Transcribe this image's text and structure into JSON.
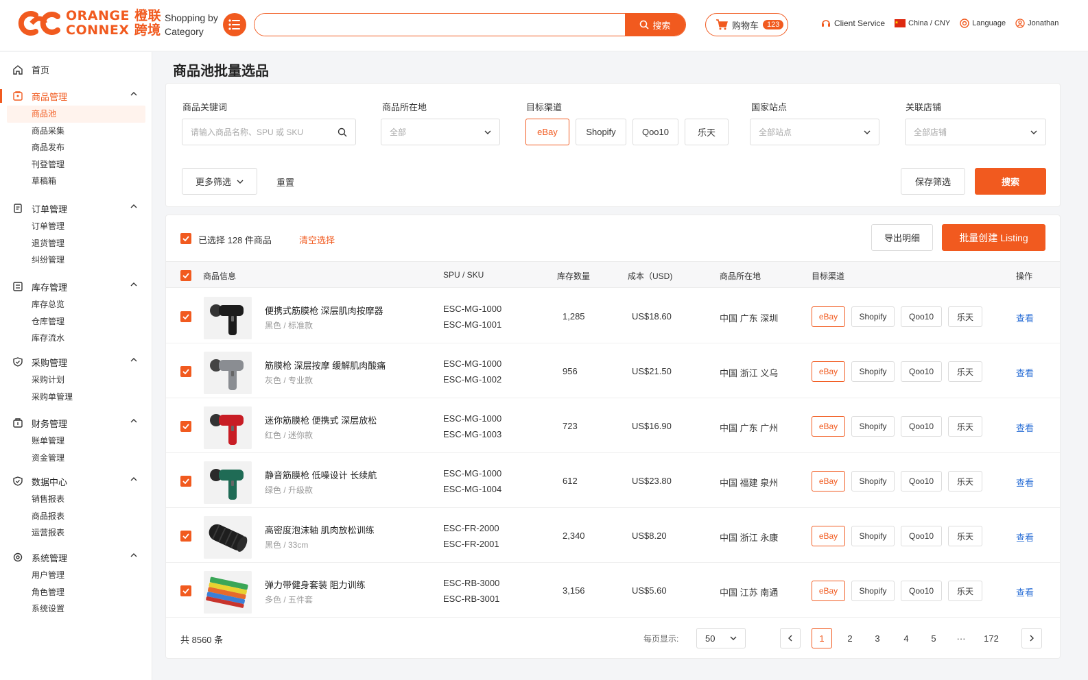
{
  "header": {
    "logo_line1": "ORANGE 橙联",
    "logo_line2": "CONNEX 跨境",
    "category_line1": "Shopping by",
    "category_line2": "Category",
    "search_button": "搜索",
    "cart_label": "购物车",
    "cart_count": "123",
    "client_service": "Client Service",
    "region": "China / CNY",
    "language": "Language",
    "user": "Jonathan"
  },
  "sidebar": {
    "home": "首页",
    "groups": [
      {
        "label": "商品管理",
        "items": [
          "商品池",
          "商品采集",
          "商品发布",
          "刊登管理",
          "草稿箱"
        ]
      },
      {
        "label": "订单管理",
        "items": [
          "订单管理",
          "退货管理",
          "纠纷管理"
        ]
      },
      {
        "label": "库存管理",
        "items": [
          "库存总览",
          "仓库管理",
          "库存流水"
        ]
      },
      {
        "label": "采购管理",
        "items": [
          "采购计划",
          "采购单管理"
        ]
      },
      {
        "label": "财务管理",
        "items": [
          "账单管理",
          "资金管理"
        ]
      },
      {
        "label": "数据中心",
        "items": [
          "销售报表",
          "商品报表",
          "运营报表"
        ]
      },
      {
        "label": "系统管理",
        "items": [
          "用户管理",
          "角色管理",
          "系统设置"
        ]
      }
    ]
  },
  "page": {
    "title": "商品池批量选品"
  },
  "filters": {
    "keyword_label": "商品关键词",
    "keyword_placeholder": "请输入商品名称、SPU 或 SKU",
    "location_label": "商品所在地",
    "location_value": "全部",
    "channel_label": "目标渠道",
    "channels": [
      "eBay",
      "Shopify",
      "Qoo10",
      "乐天"
    ],
    "site_label": "国家站点",
    "site_value": "全部站点",
    "store_label": "关联店铺",
    "store_value": "全部店铺",
    "more": "更多筛选",
    "reset": "重置",
    "save": "保存筛选",
    "search": "搜索"
  },
  "selection": {
    "text": "已选择 128 件商品",
    "clear": "清空选择",
    "export": "导出明细",
    "batch_create": "批量创建 Listing"
  },
  "table": {
    "headers": {
      "info": "商品信息",
      "sku": "SPU / SKU",
      "stock": "库存数量",
      "cost": "成本（USD)",
      "location": "商品所在地",
      "channel": "目标渠道",
      "action": "操作"
    },
    "rows": [
      {
        "name": "便携式筋膜枪 深层肌肉按摩器",
        "variant": "黑色 / 标准款",
        "spu": "ESC-MG-1000",
        "sku": "ESC-MG-1001",
        "stock": "1,285",
        "cost": "US$18.60",
        "location": "中国 广东 深圳",
        "img": "gun-black"
      },
      {
        "name": "筋膜枪 深层按摩 缓解肌肉酸痛",
        "variant": "灰色 / 专业款",
        "spu": "ESC-MG-1000",
        "sku": "ESC-MG-1002",
        "stock": "956",
        "cost": "US$21.50",
        "location": "中国 浙江 义乌",
        "img": "gun-grey"
      },
      {
        "name": "迷你筋膜枪 便携式 深层放松",
        "variant": "红色 / 迷你款",
        "spu": "ESC-MG-1000",
        "sku": "ESC-MG-1003",
        "stock": "723",
        "cost": "US$16.90",
        "location": "中国 广东 广州",
        "img": "gun-red"
      },
      {
        "name": "静音筋膜枪 低噪设计 长续航",
        "variant": "绿色 / 升级款",
        "spu": "ESC-MG-1000",
        "sku": "ESC-MG-1004",
        "stock": "612",
        "cost": "US$23.80",
        "location": "中国 福建 泉州",
        "img": "gun-green"
      },
      {
        "name": "高密度泡沫轴 肌肉放松训练",
        "variant": "黑色 / 33cm",
        "spu": "ESC-FR-2000",
        "sku": "ESC-FR-2001",
        "stock": "2,340",
        "cost": "US$8.20",
        "location": "中国 浙江 永康",
        "img": "roller"
      },
      {
        "name": "弹力带健身套装 阻力训练",
        "variant": "多色 / 五件套",
        "spu": "ESC-RB-3000",
        "sku": "ESC-RB-3001",
        "stock": "3,156",
        "cost": "US$5.60",
        "location": "中国 江苏 南通",
        "img": "bands"
      }
    ],
    "view_label": "查看"
  },
  "pager": {
    "total": "共 8560 条",
    "per_page_label": "每页显示:",
    "per_page": "50",
    "pages": [
      "1",
      "2",
      "3",
      "4",
      "5",
      "···",
      "172"
    ]
  },
  "colors": {
    "accent": "#f15a1f",
    "link": "#2b6fd6"
  }
}
